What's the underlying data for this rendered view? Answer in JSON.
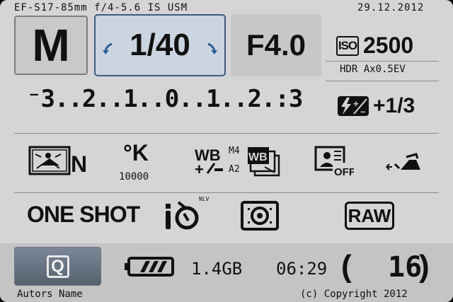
{
  "status": {
    "lens": "EF-S17-85mm f/4-5.6 IS USM",
    "date": "29.12.2012"
  },
  "exposure": {
    "mode": "M",
    "shutter": "1/40",
    "aperture": "F4.0",
    "iso_label": "ISO",
    "iso": "2500",
    "hdr": "HDR Ax0.5EV",
    "scale": "⁻3..2..1..0..1..2.:3",
    "flash_comp": "+1/3"
  },
  "settings": {
    "wb_kelvin": "10000",
    "wb_shift_a": "M4",
    "wb_shift_b": "A2",
    "wb_label": "WB",
    "af_mode": "ONE SHOT",
    "drive_tag": "NLV",
    "quality": "RAW",
    "picture_style": "N",
    "k_symbol": "°K",
    "off_label": "OFF"
  },
  "footer": {
    "q_label": "Q",
    "battery_level": 0.75,
    "free_space": "1.4GB",
    "time": "06:29",
    "shots": "16",
    "author": "Autors Name",
    "copyright": "(c) Copyright 2012"
  }
}
